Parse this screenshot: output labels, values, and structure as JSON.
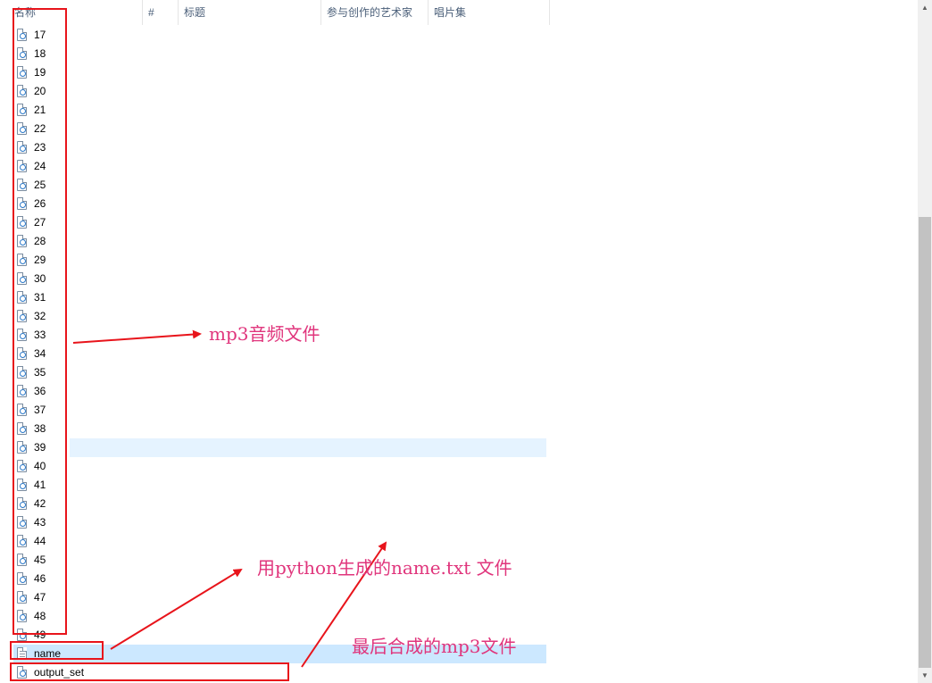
{
  "columns": [
    {
      "id": "name",
      "label": "名称"
    },
    {
      "id": "num",
      "label": "#"
    },
    {
      "id": "title",
      "label": "标题"
    },
    {
      "id": "artist",
      "label": "参与创作的艺术家"
    },
    {
      "id": "album",
      "label": "唱片集"
    }
  ],
  "files": [
    {
      "name": "17",
      "type": "audio"
    },
    {
      "name": "18",
      "type": "audio"
    },
    {
      "name": "19",
      "type": "audio"
    },
    {
      "name": "20",
      "type": "audio"
    },
    {
      "name": "21",
      "type": "audio"
    },
    {
      "name": "22",
      "type": "audio"
    },
    {
      "name": "23",
      "type": "audio"
    },
    {
      "name": "24",
      "type": "audio"
    },
    {
      "name": "25",
      "type": "audio"
    },
    {
      "name": "26",
      "type": "audio"
    },
    {
      "name": "27",
      "type": "audio"
    },
    {
      "name": "28",
      "type": "audio"
    },
    {
      "name": "29",
      "type": "audio"
    },
    {
      "name": "30",
      "type": "audio"
    },
    {
      "name": "31",
      "type": "audio"
    },
    {
      "name": "32",
      "type": "audio"
    },
    {
      "name": "33",
      "type": "audio"
    },
    {
      "name": "34",
      "type": "audio"
    },
    {
      "name": "35",
      "type": "audio"
    },
    {
      "name": "36",
      "type": "audio"
    },
    {
      "name": "37",
      "type": "audio"
    },
    {
      "name": "38",
      "type": "audio"
    },
    {
      "name": "39",
      "type": "audio",
      "state": "hover"
    },
    {
      "name": "40",
      "type": "audio"
    },
    {
      "name": "41",
      "type": "audio"
    },
    {
      "name": "42",
      "type": "audio"
    },
    {
      "name": "43",
      "type": "audio"
    },
    {
      "name": "44",
      "type": "audio"
    },
    {
      "name": "45",
      "type": "audio"
    },
    {
      "name": "46",
      "type": "audio"
    },
    {
      "name": "47",
      "type": "audio"
    },
    {
      "name": "48",
      "type": "audio"
    },
    {
      "name": "49",
      "type": "audio"
    },
    {
      "name": "name",
      "type": "text",
      "state": "selected"
    },
    {
      "name": "output_set",
      "type": "audio"
    }
  ],
  "annotations": {
    "mp3_label": "mp3音频文件",
    "name_txt_label": "用python生成的name.txt 文件",
    "output_label": "最后合成的mp3文件"
  },
  "colors": {
    "annotation_box": "#e8141b",
    "annotation_text": "#e0357c",
    "hover_row": "#e5f3ff",
    "selected_row": "#cce8ff"
  }
}
